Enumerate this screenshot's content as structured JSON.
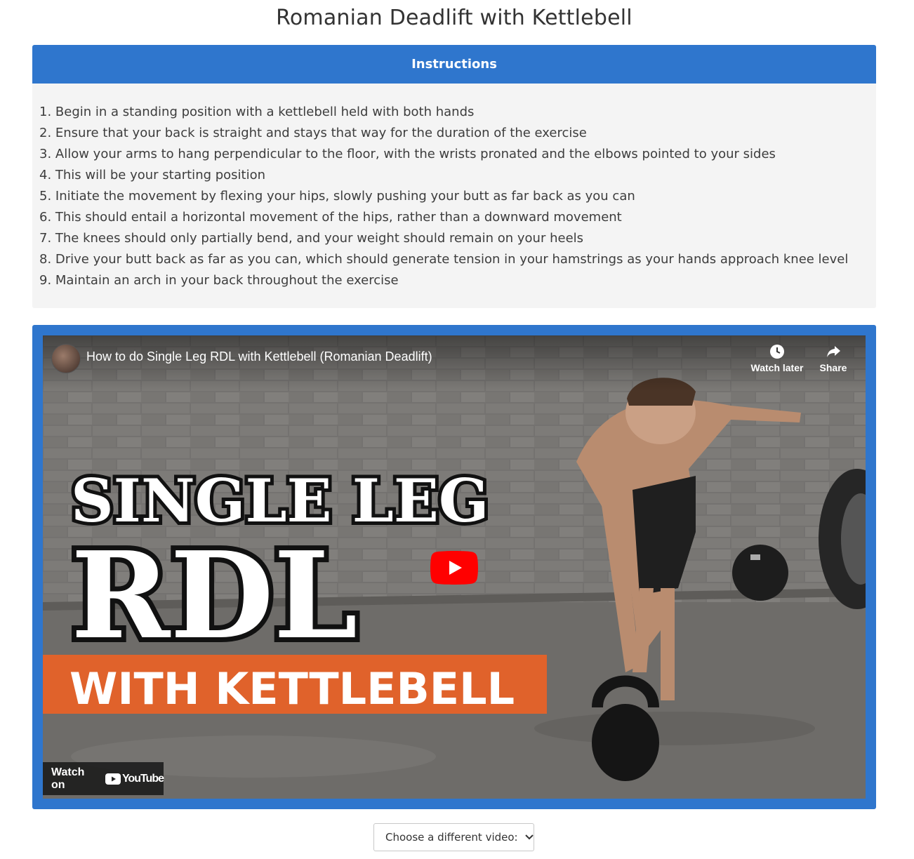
{
  "page": {
    "title": "Romanian Deadlift with Kettlebell"
  },
  "instructions": {
    "header": "Instructions",
    "steps": [
      "1. Begin in a standing position with a kettlebell held with both hands",
      "2. Ensure that your back is straight and stays that way for the duration of the exercise",
      "3. Allow your arms to hang perpendicular to the floor, with the wrists pronated and the elbows pointed to your sides",
      "4. This will be your starting position",
      "5. Initiate the movement by flexing your hips, slowly pushing your butt as far back as you can",
      "6. This should entail a horizontal movement of the hips, rather than a downward movement",
      "7. The knees should only partially bend, and your weight should remain on your heels",
      "8. Drive your butt back as far as you can, which should generate tension in your hamstrings as your hands approach knee level",
      "9. Maintain an arch in your back throughout the exercise"
    ]
  },
  "video": {
    "title": "How to do Single Leg RDL with Kettlebell (Romanian Deadlift)",
    "watch_later_label": "Watch later",
    "share_label": "Share",
    "thumbnail_text": {
      "line1": "SINGLE LEG",
      "line2": "RDL",
      "line3": "WITH KETTLEBELL"
    },
    "watch_on_label": "Watch on",
    "youtube_label": "YouTube",
    "icons": [
      "clock-icon",
      "share-arrow-icon",
      "play-icon",
      "youtube-logo-icon",
      "channel-avatar"
    ]
  },
  "video_select": {
    "selected": "Choose a different video:",
    "icon": "chevron-down-icon"
  },
  "colors": {
    "accent": "#2f76cd",
    "panel_bg": "#f4f4f4",
    "banner_orange": "#e0622b",
    "youtube_red": "#ff0000"
  }
}
